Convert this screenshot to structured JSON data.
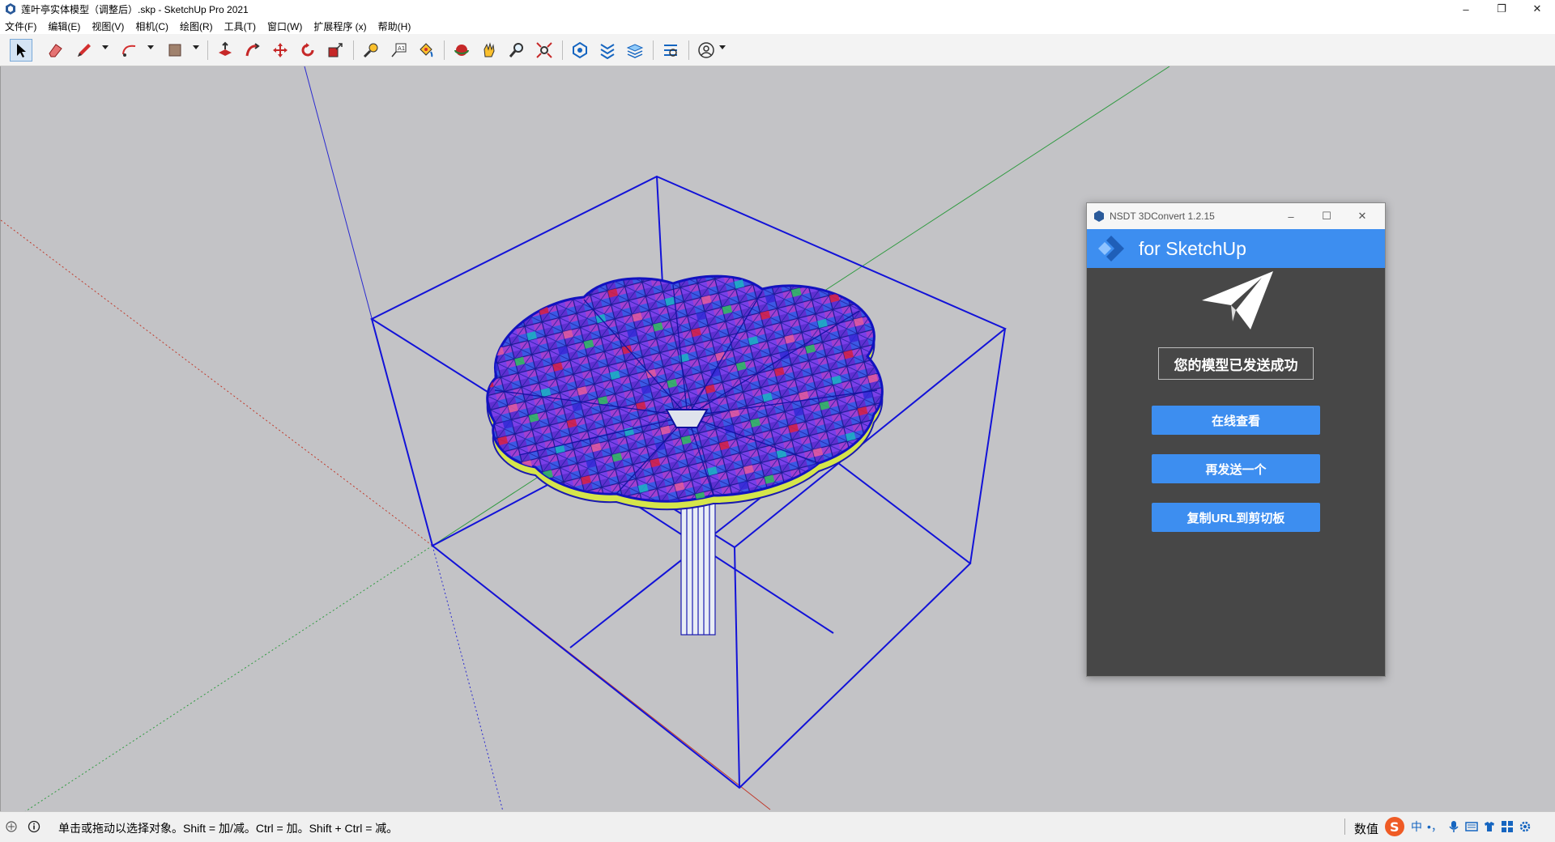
{
  "window": {
    "title": "莲叶亭实体模型（调整后）.skp - SketchUp Pro 2021",
    "app_icon": "sketchup-icon",
    "controls": {
      "minimize": "–",
      "restore": "❐",
      "close": "✕"
    }
  },
  "menu": {
    "items": [
      {
        "label": "文件(F)"
      },
      {
        "label": "编辑(E)"
      },
      {
        "label": "视图(V)"
      },
      {
        "label": "相机(C)"
      },
      {
        "label": "绘图(R)"
      },
      {
        "label": "工具(T)"
      },
      {
        "label": "窗口(W)"
      },
      {
        "label": "扩展程序 (x)"
      },
      {
        "label": "帮助(H)"
      }
    ]
  },
  "toolbar": {
    "tools": [
      {
        "icon": "select-arrow-icon",
        "active": true
      },
      {
        "icon": "eraser-icon"
      },
      {
        "icon": "pencil-line-icon"
      },
      {
        "icon": "arc-icon"
      },
      {
        "icon": "rectangle-shape-icon"
      },
      {
        "icon": "push-pull-icon"
      },
      {
        "icon": "follow-me-icon"
      },
      {
        "icon": "move-icon"
      },
      {
        "icon": "rotate-icon"
      },
      {
        "icon": "scale-icon"
      },
      {
        "icon": "tape-measure-icon"
      },
      {
        "icon": "text-label-icon"
      },
      {
        "icon": "paint-bucket-icon"
      },
      {
        "icon": "orbit-icon"
      },
      {
        "icon": "pan-hand-icon"
      },
      {
        "icon": "zoom-icon"
      },
      {
        "icon": "zoom-extents-icon"
      },
      {
        "icon": "warehouse-icon"
      },
      {
        "icon": "extension-warehouse-icon"
      },
      {
        "icon": "layout-icon"
      },
      {
        "icon": "extension-manager-icon"
      },
      {
        "icon": "account-user-icon"
      }
    ]
  },
  "dialog": {
    "title": "NSDT 3DConvert 1.2.15",
    "header": "for SketchUp",
    "success_message": "您的模型已发送成功",
    "buttons": {
      "view_online": "在线查看",
      "send_another": "再发送一个",
      "copy_url": "复制URL到剪切板"
    },
    "colors": {
      "accent": "#3d8ef0",
      "panel": "#474747"
    }
  },
  "status": {
    "hint": "单击或拖动以选择对象。Shift = 加/减。Ctrl = 加。Shift + Ctrl = 减。",
    "measurement_label": "数值",
    "tray": {
      "ime_lang": "中",
      "punct": "•，"
    }
  }
}
